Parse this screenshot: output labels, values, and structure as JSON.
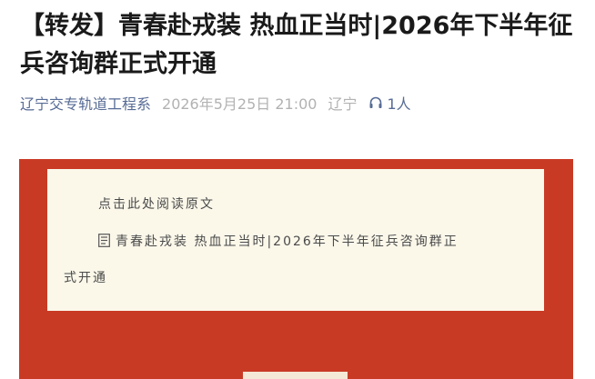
{
  "article": {
    "title": "【转发】青春赴戎装 热血正当时|2026年下半年征兵咨询群正式开通",
    "account_name": "辽宁交专轨道工程系",
    "publish_time": "2026年5月25日 21:00",
    "region": "辽宁",
    "listener_count": "1人",
    "listener_icon": "headphones-icon"
  },
  "banner": {
    "read_original": "点击此处阅读原文",
    "link_title_line1": "青春赴戎装 热血正当时|2026年下半年征兵咨询群正",
    "link_title_line2": "式开通",
    "link_icon": "document-icon"
  },
  "colors": {
    "banner_red": "#c93a25",
    "card_cream": "#fbf8ea",
    "link_blue": "#576b95",
    "meta_gray": "#b2b2b2"
  }
}
